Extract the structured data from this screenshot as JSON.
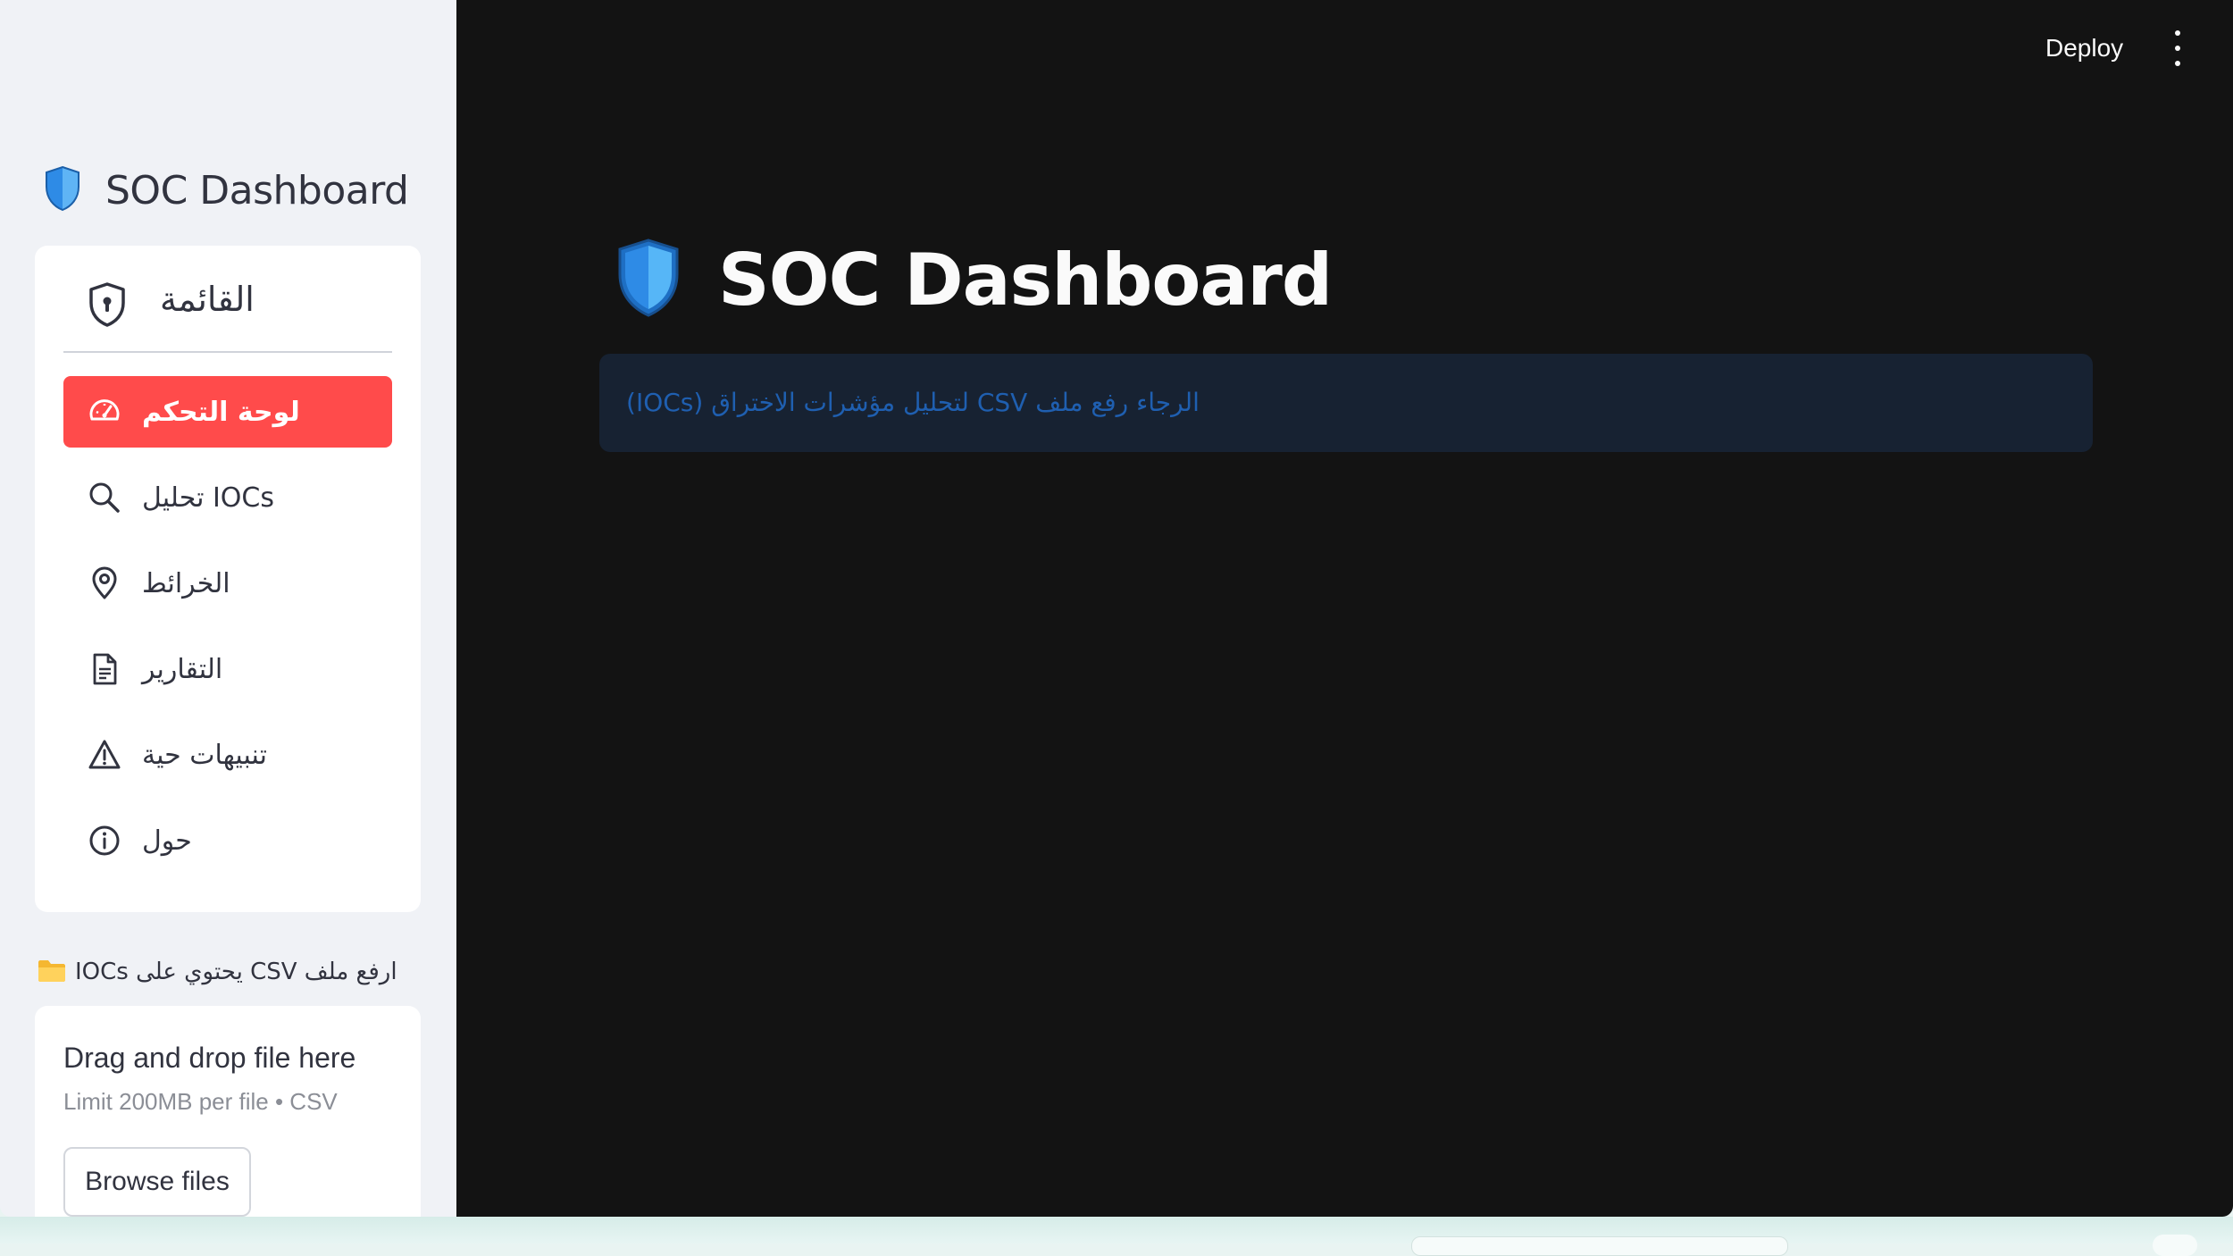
{
  "sidebar": {
    "title": "SOC Dashboard",
    "menu": {
      "header": "القائمة",
      "items": [
        {
          "label": "لوحة التحكم",
          "icon": "speedometer-icon",
          "active": true
        },
        {
          "label": "تحليل IOCs",
          "icon": "search-icon",
          "active": false
        },
        {
          "label": "الخرائط",
          "icon": "map-pin-icon",
          "active": false
        },
        {
          "label": "التقارير",
          "icon": "document-icon",
          "active": false
        },
        {
          "label": "تنبيهات حية",
          "icon": "warning-triangle-icon",
          "active": false
        },
        {
          "label": "حول",
          "icon": "info-icon",
          "active": false
        }
      ]
    },
    "upload": {
      "label": "ارفع ملف CSV يحتوي على IOCs",
      "drag_text": "Drag and drop file here",
      "limit_text": "Limit 200MB per file • CSV",
      "browse_label": "Browse files"
    }
  },
  "header": {
    "deploy_label": "Deploy"
  },
  "main": {
    "title": "SOC Dashboard",
    "info_message": "الرجاء رفع ملف CSV لتحليل مؤشرات الاختراق (IOCs)"
  },
  "colors": {
    "accent": "#ff4b4b",
    "sidebar_bg": "#f0f2f6",
    "main_bg": "#131313",
    "info_bg": "#172232",
    "info_text": "#1f5fb0",
    "shield_blue": "#2e8be6"
  }
}
